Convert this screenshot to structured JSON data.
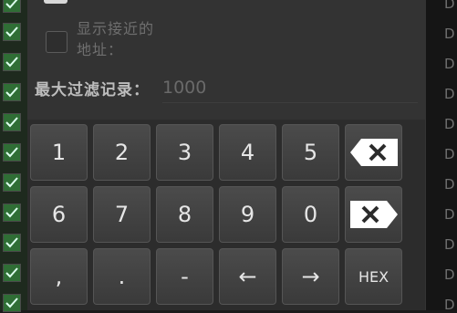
{
  "dialog": {
    "option_label": "显示接近的地址：",
    "max_records_label": "最大过滤记录：",
    "max_records_value": "1000"
  },
  "keypad": {
    "row1": [
      "1",
      "2",
      "3",
      "4",
      "5"
    ],
    "row2": [
      "6",
      "7",
      "8",
      "9",
      "0"
    ],
    "row3": [
      ",",
      ".",
      "-",
      "←",
      "→"
    ],
    "hex_label": "HEX"
  },
  "right_strip": {
    "letter": "D"
  },
  "colors": {
    "check_green": "#2f6e35",
    "keypad_bg": "#2c2c2c",
    "key_text": "#e6e6e6"
  }
}
